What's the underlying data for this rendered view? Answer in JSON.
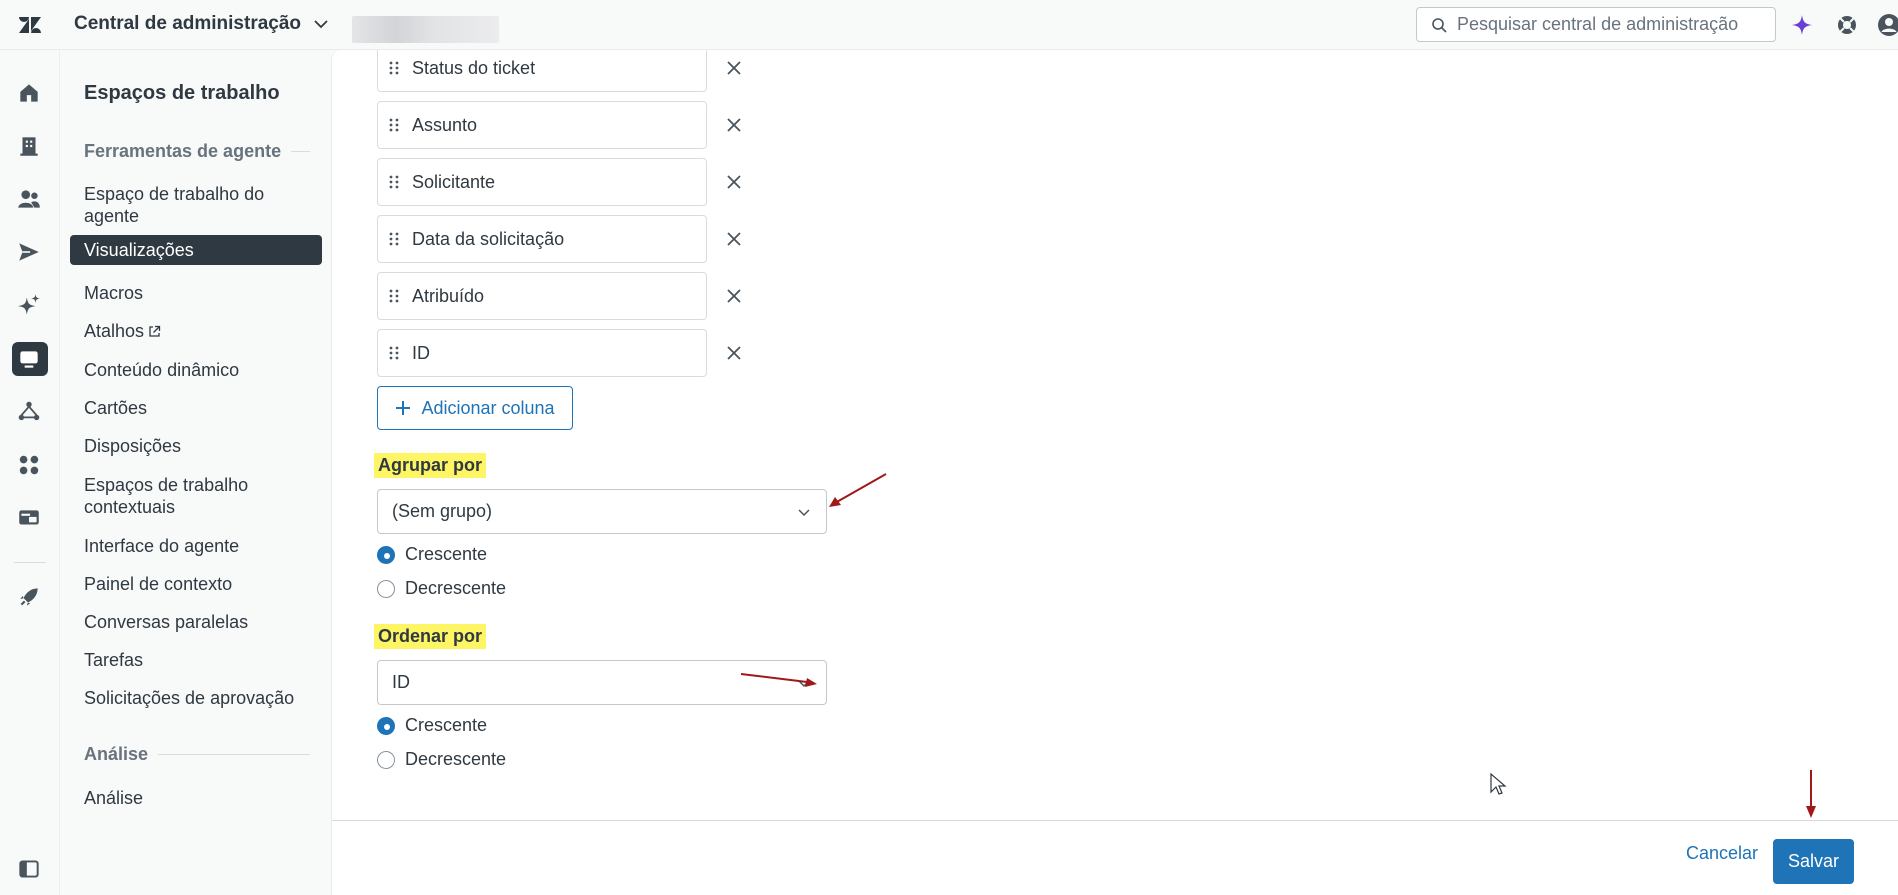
{
  "topbar": {
    "product_name": "Central de administração",
    "search_placeholder": "Pesquisar central de administração"
  },
  "nav": {
    "title": "Espaços de trabalho",
    "section_agent_tools": "Ferramentas de agente",
    "items": [
      {
        "label": "Espaço de trabalho do agente"
      },
      {
        "label": "Visualizações"
      },
      {
        "label": "Macros"
      },
      {
        "label": "Atalhos"
      },
      {
        "label": "Conteúdo dinâmico"
      },
      {
        "label": "Cartões"
      },
      {
        "label": "Disposições"
      },
      {
        "label": "Espaços de trabalho contextuais"
      },
      {
        "label": "Interface do agente"
      },
      {
        "label": "Painel de contexto"
      },
      {
        "label": "Conversas paralelas"
      },
      {
        "label": "Tarefas"
      },
      {
        "label": "Solicitações de aprovação"
      }
    ],
    "section_analysis": "Análise",
    "analysis_item": "Análise"
  },
  "columns": [
    {
      "label": "Status do ticket"
    },
    {
      "label": "Assunto"
    },
    {
      "label": "Solicitante"
    },
    {
      "label": "Data da solicitação"
    },
    {
      "label": "Atribuído"
    },
    {
      "label": "ID"
    }
  ],
  "add_column_label": "Adicionar coluna",
  "group_by": {
    "label": "Agrupar por",
    "value": "(Sem grupo)",
    "ascending": "Crescente",
    "descending": "Decrescente",
    "selected": "ascending"
  },
  "order_by": {
    "label": "Ordenar por",
    "value": "ID",
    "ascending": "Crescente",
    "descending": "Decrescente",
    "selected": "ascending"
  },
  "footer": {
    "cancel_label": "Cancelar",
    "save_label": "Salvar"
  },
  "colors": {
    "accent": "#1f73b7",
    "highlight": "#fdf563",
    "annotation_arrow": "#a01818",
    "active_nav": "#2f3941"
  }
}
